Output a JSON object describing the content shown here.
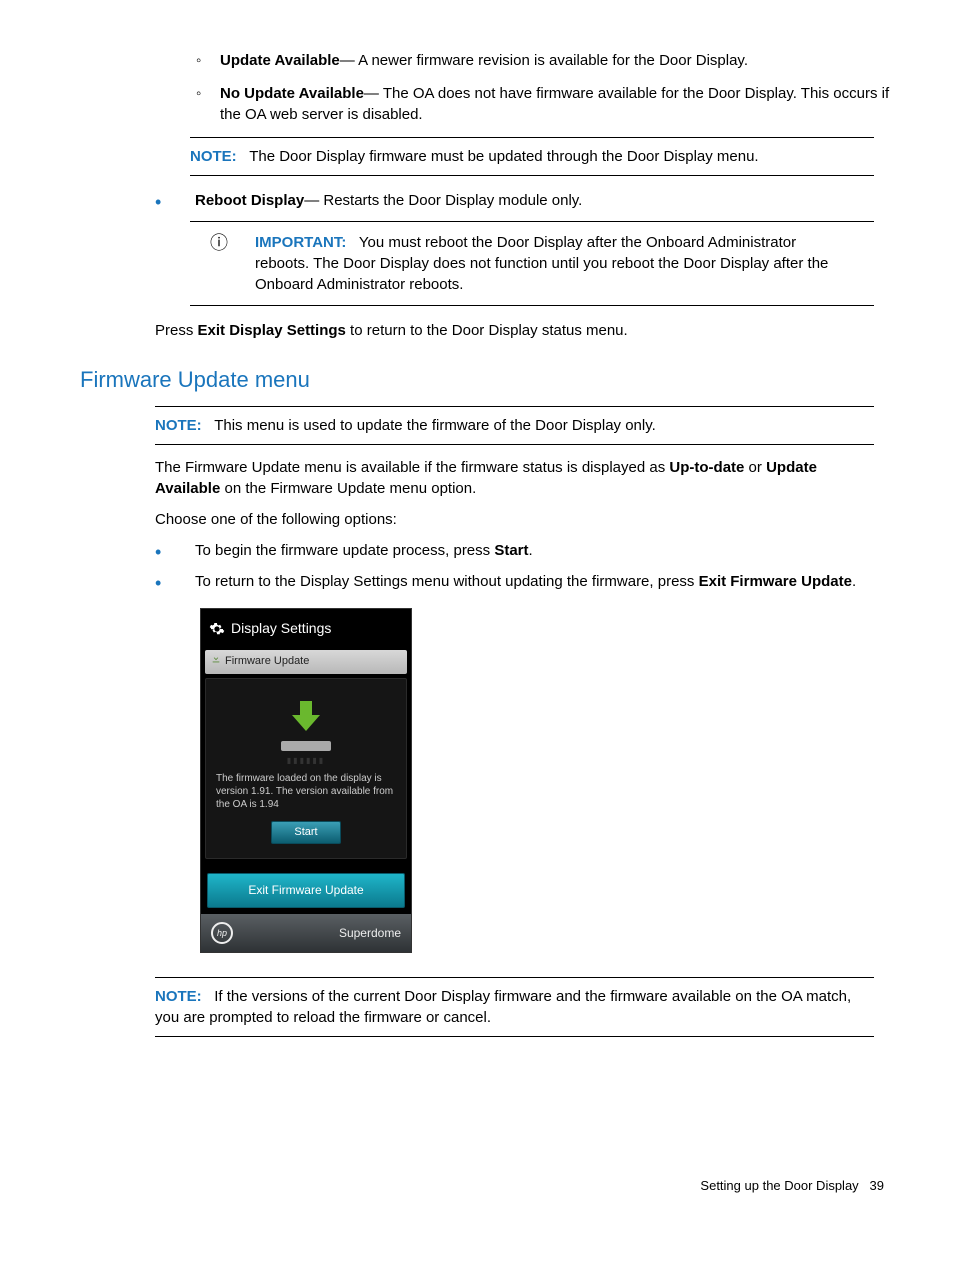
{
  "top_list": {
    "update_available": {
      "label": "Update Available",
      "desc": "— A newer firmware revision is available for the Door Display."
    },
    "no_update": {
      "label": "No Update Available",
      "desc": "— The OA does not have firmware available for the Door Display. This occurs if the OA web server is disabled."
    }
  },
  "note1": {
    "label": "NOTE:",
    "text": "The Door Display firmware must be updated through the Door Display menu."
  },
  "reboot": {
    "label": "Reboot Display",
    "desc": "— Restarts the Door Display module only."
  },
  "important": {
    "label": "IMPORTANT:",
    "text": "You must reboot the Door Display after the Onboard Administrator reboots. The Door Display does not function until you reboot the Door Display after the Onboard Administrator reboots."
  },
  "press_exit": {
    "pre": "Press ",
    "bold": "Exit Display Settings",
    "post": " to return to the Door Display status menu."
  },
  "section_heading": "Firmware Update menu",
  "note2": {
    "label": "NOTE:",
    "text": "This menu is used to update the firmware of the Door Display only."
  },
  "para1": {
    "pre": "The Firmware Update menu is available if the firmware status is displayed as ",
    "b1": "Up-to-date",
    "mid": " or ",
    "b2": "Update Available",
    "post": " on the Firmware Update menu option."
  },
  "para2": "Choose one of the following options:",
  "opt1": {
    "pre": "To begin the firmware update process, press ",
    "bold": "Start",
    "post": "."
  },
  "opt2": {
    "pre": "To return to the Display Settings menu without updating the firmware, press ",
    "bold": "Exit Firmware Update",
    "post": "."
  },
  "screenshot": {
    "header": "Display Settings",
    "subheader": "Firmware Update",
    "fw_text": "The firmware loaded on the display is version 1.91.  The version available from the OA is 1.94",
    "start_btn": "Start",
    "exit_btn": "Exit Firmware Update",
    "footer_brand": "Superdome"
  },
  "note3": {
    "label": "NOTE:",
    "text": "If the versions of the current Door Display firmware and the firmware available on the OA match, you are prompted to reload the firmware or cancel."
  },
  "footer": {
    "section": "Setting up the Door Display",
    "page": "39"
  }
}
